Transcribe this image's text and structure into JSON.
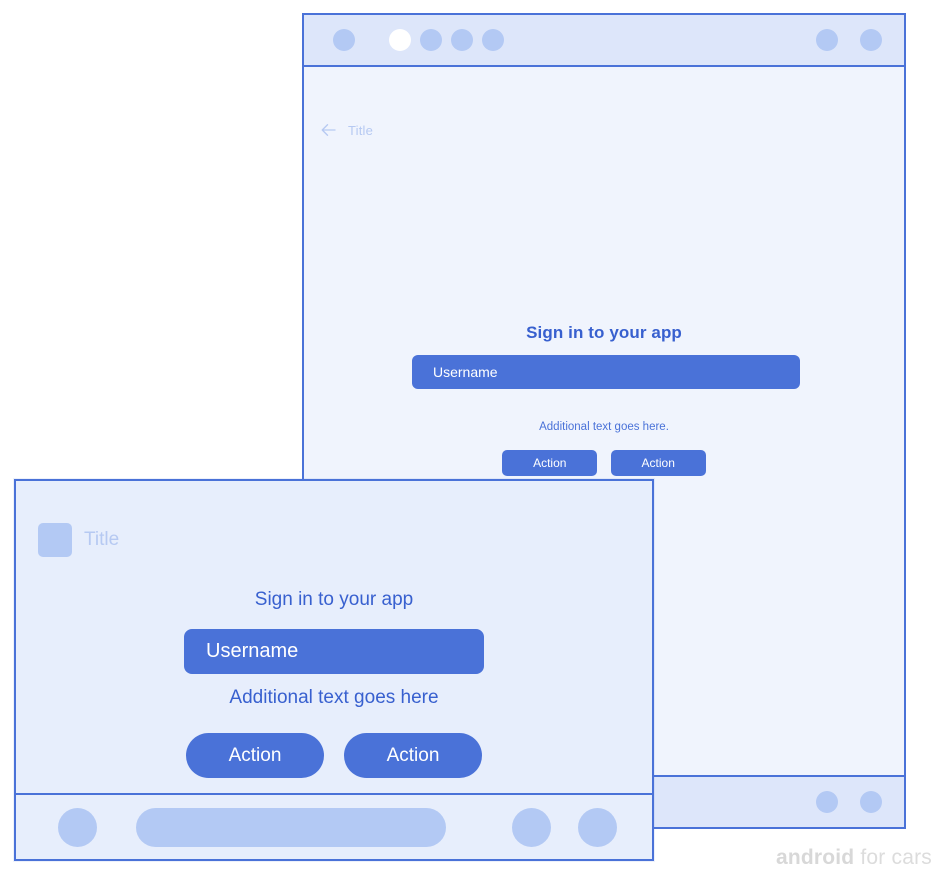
{
  "colors": {
    "accent": "#4a72d8",
    "accent_text": "#3860cf",
    "surface_light": "#f0f4fd",
    "surface_front": "#e7eefc",
    "system_bar": "#dde6fa",
    "placeholder_blue": "#b3c9f4",
    "muted_title": "#b6c9f2",
    "watermark": "#dcdcdc",
    "selected_dot": "#ffffff"
  },
  "back_window": {
    "system_bar_top": {
      "left_dots": [
        {
          "name": "dot-1",
          "state": "normal"
        },
        {
          "name": "dot-2",
          "state": "selected"
        },
        {
          "name": "dot-3",
          "state": "normal"
        },
        {
          "name": "dot-4",
          "state": "normal"
        },
        {
          "name": "dot-5",
          "state": "normal"
        }
      ],
      "right_dots": [
        {
          "name": "dot-status-1",
          "state": "normal"
        },
        {
          "name": "dot-status-2",
          "state": "normal"
        }
      ]
    },
    "app_bar": {
      "back_icon": "arrow-left-icon",
      "title": "Title"
    },
    "sign_in": {
      "headline": "Sign in to your app",
      "username_value": "Username",
      "username_placeholder": "Username",
      "helper_text": "Additional text goes here.",
      "buttons": [
        {
          "label": "Action"
        },
        {
          "label": "Action"
        }
      ]
    },
    "system_bar_bottom": {
      "right_dots": [
        {
          "name": "dot-nav-1",
          "state": "normal"
        },
        {
          "name": "dot-nav-2",
          "state": "normal"
        }
      ]
    }
  },
  "front_window": {
    "app_bar": {
      "icon": "app-square-icon",
      "title": "Title"
    },
    "sign_in": {
      "headline": "Sign in to your app",
      "username_value": "Username",
      "username_placeholder": "Username",
      "helper_text": "Additional text goes here",
      "buttons": [
        {
          "label": "Action"
        },
        {
          "label": "Action"
        }
      ]
    },
    "nav_bar": {
      "items": [
        {
          "name": "nav-circle-left",
          "shape": "circle"
        },
        {
          "name": "nav-pill-center",
          "shape": "pill"
        },
        {
          "name": "nav-circle-right-1",
          "shape": "circle"
        },
        {
          "name": "nav-circle-right-2",
          "shape": "circle"
        }
      ]
    }
  },
  "watermark": {
    "bold": "android",
    "light": " for cars"
  }
}
